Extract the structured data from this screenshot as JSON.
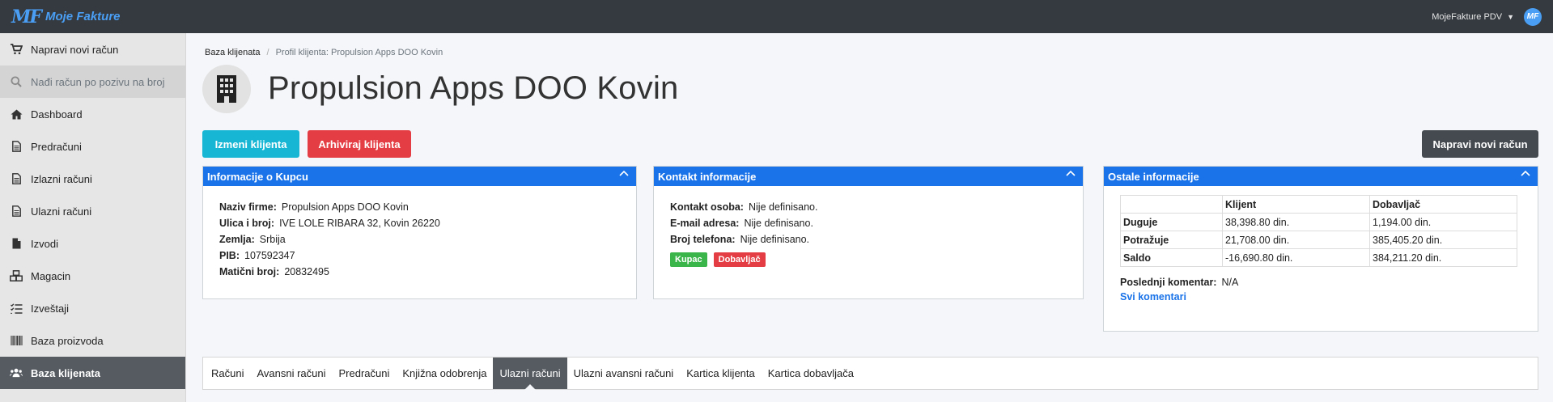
{
  "topbar": {
    "brand_mark": "MF",
    "brand_name": "Moje Fakture",
    "account_label": "MojeFakture PDV",
    "avatar_text": "MF"
  },
  "sidebar": {
    "items": [
      {
        "label": "Napravi novi račun",
        "icon": "cart-icon"
      },
      {
        "label": "Nađi račun po pozivu na broj",
        "icon": "search-icon"
      },
      {
        "label": "Dashboard",
        "icon": "home-icon"
      },
      {
        "label": "Predračuni",
        "icon": "document-icon"
      },
      {
        "label": "Izlazni računi",
        "icon": "document-icon"
      },
      {
        "label": "Ulazni računi",
        "icon": "document-icon"
      },
      {
        "label": "Izvodi",
        "icon": "file-icon"
      },
      {
        "label": "Magacin",
        "icon": "boxes-icon"
      },
      {
        "label": "Izveštaji",
        "icon": "list-icon"
      },
      {
        "label": "Baza proizvoda",
        "icon": "barcode-icon"
      },
      {
        "label": "Baza klijenata",
        "icon": "users-icon"
      }
    ]
  },
  "breadcrumb": {
    "root": "Baza klijenata",
    "separator": "/",
    "current": "Profil klijenta: Propulsion Apps DOO Kovin"
  },
  "page": {
    "title": "Propulsion Apps DOO Kovin"
  },
  "buttons": {
    "edit": "Izmeni klijenta",
    "archive": "Arhiviraj klijenta",
    "new_invoice": "Napravi novi račun"
  },
  "kupac_card": {
    "title": "Informacije o Kupcu",
    "rows": [
      {
        "key": "Naziv firme:",
        "value": "Propulsion Apps DOO Kovin"
      },
      {
        "key": "Ulica i broj:",
        "value": "IVE LOLE RIBARA 32, Kovin 26220"
      },
      {
        "key": "Zemlja:",
        "value": "Srbija"
      },
      {
        "key": "PIB:",
        "value": "107592347"
      },
      {
        "key": "Matični broj:",
        "value": "20832495"
      }
    ]
  },
  "kontakt_card": {
    "title": "Kontakt informacije",
    "rows": [
      {
        "key": "Kontakt osoba:",
        "value": "Nije definisano."
      },
      {
        "key": "E-mail adresa:",
        "value": "Nije definisano."
      },
      {
        "key": "Broj telefona:",
        "value": "Nije definisano."
      }
    ],
    "badges": [
      {
        "label": "Kupac",
        "color": "#3ab54a"
      },
      {
        "label": "Dobavljač",
        "color": "#e43d43"
      }
    ]
  },
  "ostale_card": {
    "title": "Ostale informacije",
    "table": {
      "headers": [
        "",
        "Klijent",
        "Dobavljač"
      ],
      "rows": [
        {
          "label": "Duguje",
          "klijent": "38,398.80 din.",
          "dobavljac": "1,194.00 din."
        },
        {
          "label": "Potražuje",
          "klijent": "21,708.00 din.",
          "dobavljac": "385,405.20 din."
        },
        {
          "label": "Saldo",
          "klijent": "-16,690.80 din.",
          "dobavljac": "384,211.20 din."
        }
      ]
    },
    "komentar_key": "Poslednji komentar:",
    "komentar_value": "N/A",
    "svi_komentari": "Svi komentari"
  },
  "tabs": {
    "items": [
      "Računi",
      "Avansni računi",
      "Predračuni",
      "Knjižna odobrenja",
      "Ulazni računi",
      "Ulazni avansni računi",
      "Kartica klijenta",
      "Kartica dobavljača"
    ],
    "active": "Ulazni računi"
  },
  "colors": {
    "topbar": "#343a40",
    "brand": "#4a9ff5",
    "card_header": "#1a73e8",
    "info_button": "#17b6d4",
    "danger_button": "#e43d43",
    "dark_button": "#454a50",
    "active_nav": "#555b61"
  }
}
